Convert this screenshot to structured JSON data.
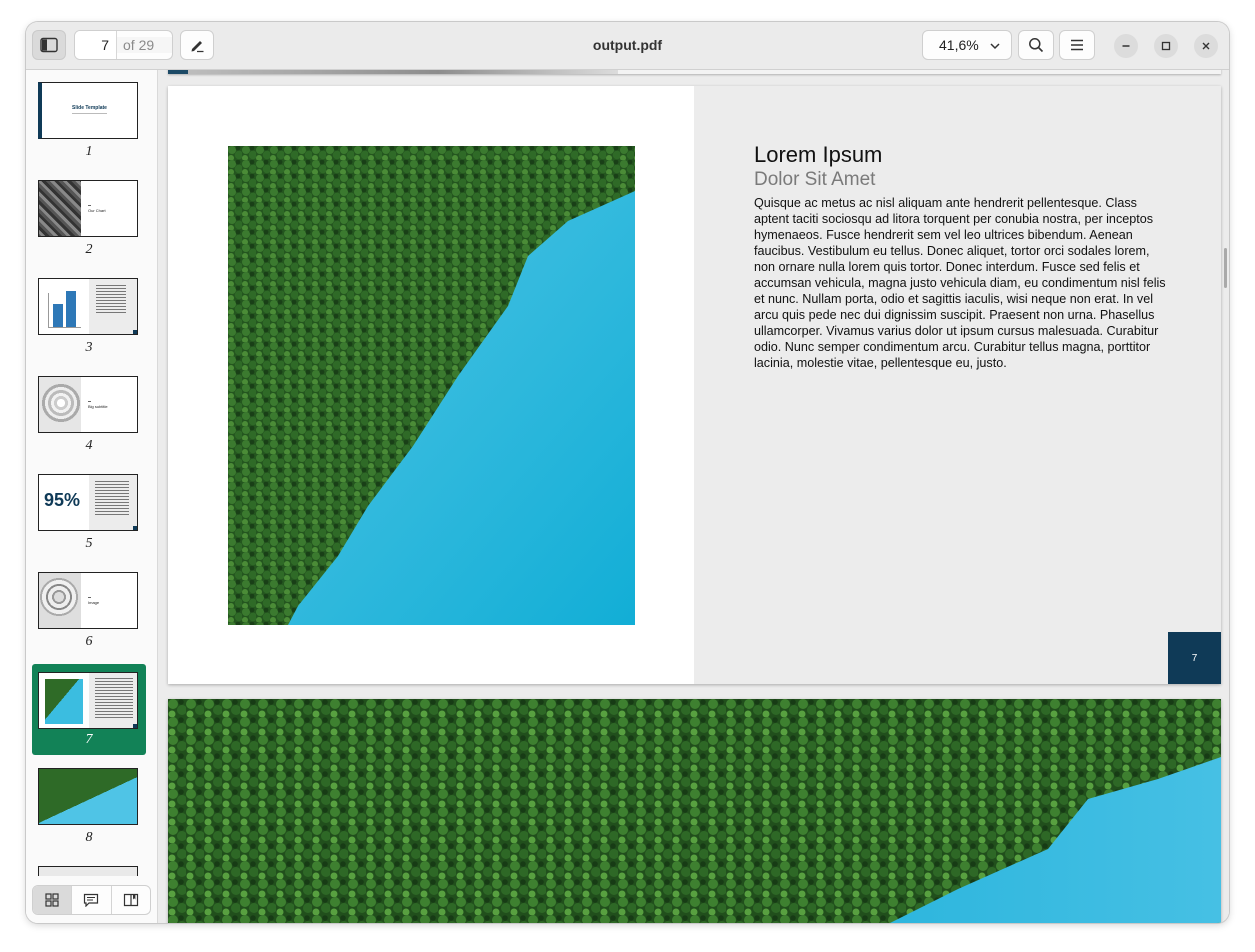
{
  "window": {
    "title": "output.pdf"
  },
  "toolbar": {
    "current_page": "7",
    "page_total": "of 29",
    "zoom": "41,6%",
    "icons": [
      "sidebar-toggle-icon",
      "pencil-annotate-icon",
      "chevron-down-icon",
      "search-icon",
      "hamburger-menu-icon",
      "minimize-icon",
      "maximize-icon",
      "close-icon"
    ]
  },
  "sidebar": {
    "selected": "7",
    "thumbnails": [
      {
        "label": "1",
        "title": "Slide Template"
      },
      {
        "label": "2",
        "title": "Our Chart"
      },
      {
        "label": "3"
      },
      {
        "label": "4",
        "title": "Big subtitle"
      },
      {
        "label": "5",
        "stat": "95%"
      },
      {
        "label": "6",
        "title": "Image"
      },
      {
        "label": "7"
      },
      {
        "label": "8"
      }
    ],
    "view_modes": [
      "grid-view-icon",
      "annotations-view-icon",
      "bookmarks-view-icon"
    ]
  },
  "document": {
    "page7": {
      "heading": "Lorem Ipsum",
      "subheading": "Dolor Sit Amet",
      "body": "Quisque ac metus ac nisl aliquam ante hendrerit pellentesque. Class aptent taciti sociosqu ad litora torquent per conubia nostra, per inceptos hymenaeos. Fusce hendrerit sem vel leo ultrices bibendum. Aenean faucibus. Vestibulum eu tellus. Donec aliquet, tortor orci sodales lorem, non ornare nulla lorem quis tortor. Donec interdum. Fusce sed felis et accumsan vehicula, magna justo vehicula diam, eu condimentum nisl felis et nunc. Nullam porta, odio et sagittis iaculis, wisi neque non erat. In vel arcu quis pede nec dui dignissim suscipit. Praesent non urna. Phasellus ullamcorper. Vivamus varius dolor ut ipsum cursus malesuada. Curabitur odio. Nunc semper condimentum arcu. Curabitur tellus magna, porttitor lacinia, molestie vitae, pellentesque eu, justo.",
      "page_number": "7"
    }
  },
  "colors": {
    "accent_selection": "#128257",
    "slide_dark": "#0f3a57",
    "forest": "#2f6e2a",
    "lake": "#2fb6dc"
  }
}
